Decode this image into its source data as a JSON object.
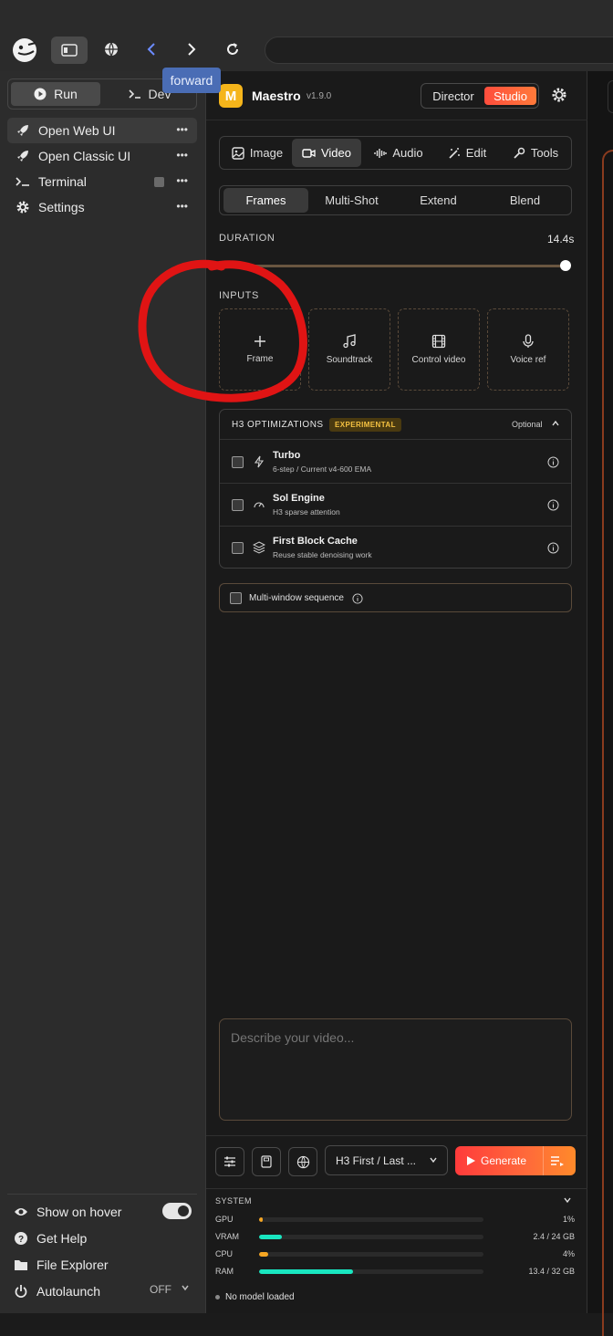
{
  "browser": {
    "tooltip": "forward"
  },
  "sidebar": {
    "run_label": "Run",
    "dev_label": "Dev",
    "items": [
      {
        "label": "Open Web UI"
      },
      {
        "label": "Open Classic UI"
      },
      {
        "label": "Terminal"
      },
      {
        "label": "Settings"
      }
    ],
    "bottom": {
      "show_on_hover": "Show on hover",
      "get_help": "Get Help",
      "file_explorer": "File Explorer",
      "autolaunch": "Autolaunch",
      "autolaunch_value": "OFF"
    }
  },
  "app": {
    "logo_letter": "M",
    "title": "Maestro",
    "version": "v1.9.0",
    "mode_director": "Director",
    "mode_studio": "Studio"
  },
  "tabs_primary": [
    {
      "label": "Image"
    },
    {
      "label": "Video"
    },
    {
      "label": "Audio"
    },
    {
      "label": "Edit"
    },
    {
      "label": "Tools"
    }
  ],
  "tabs_secondary": [
    {
      "label": "Frames"
    },
    {
      "label": "Multi-Shot"
    },
    {
      "label": "Extend"
    },
    {
      "label": "Blend"
    }
  ],
  "duration": {
    "label": "DURATION",
    "value": "14.4s"
  },
  "inputs": {
    "label": "INPUTS",
    "cards": [
      {
        "label": "Frame"
      },
      {
        "label": "Soundtrack"
      },
      {
        "label": "Control video"
      },
      {
        "label": "Voice ref"
      }
    ]
  },
  "optimizations": {
    "title": "H3 OPTIMIZATIONS",
    "badge": "EXPERIMENTAL",
    "optional": "Optional",
    "items": [
      {
        "title": "Turbo",
        "subtitle": "6-step / Current v4-600 EMA"
      },
      {
        "title": "Sol Engine",
        "subtitle": "H3 sparse attention"
      },
      {
        "title": "First Block Cache",
        "subtitle": "Reuse stable denoising work"
      }
    ]
  },
  "multi_window": {
    "label": "Multi-window sequence"
  },
  "prompt": {
    "placeholder": "Describe your video..."
  },
  "footer": {
    "model_select": "H3 First / Last ...",
    "generate_label": "Generate"
  },
  "system": {
    "label": "SYSTEM",
    "rows": [
      {
        "label": "GPU",
        "value": "1%",
        "fraction": 0.01,
        "color": "#f5a623"
      },
      {
        "label": "VRAM",
        "value": "2.4 / 24 GB",
        "fraction": 0.1,
        "color": "#19e6c0"
      },
      {
        "label": "CPU",
        "value": "4%",
        "fraction": 0.04,
        "color": "#f5a623"
      },
      {
        "label": "RAM",
        "value": "13.4 / 32 GB",
        "fraction": 0.42,
        "color": "#19e6c0"
      }
    ],
    "status": "No model loaded"
  }
}
